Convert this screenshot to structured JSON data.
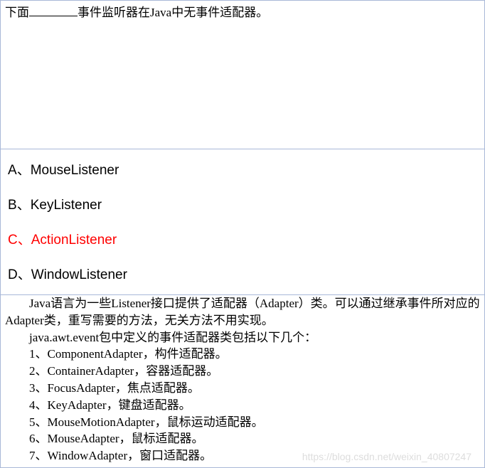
{
  "question": {
    "prefix": "下面",
    "suffix": "事件监听器在Java中无事件适配器。"
  },
  "options": [
    {
      "letter": "A",
      "text": "MouseListener",
      "correct": false
    },
    {
      "letter": "B",
      "text": "KeyListener",
      "correct": false
    },
    {
      "letter": "C",
      "text": "ActionListener",
      "correct": true
    },
    {
      "letter": "D",
      "text": "WindowListener",
      "correct": false
    }
  ],
  "sep": "、",
  "explanation": {
    "line1": "Java语言为一些Listener接口提供了适配器（Adapter）类。可以通过继承事件所对应的Adapter类，重写需要的方法，无关方法不用实现。",
    "line2": "java.awt.event包中定义的事件适配器类包括以下几个：",
    "items": [
      "1、ComponentAdapter，构件适配器。",
      "2、ContainerAdapter，容器适配器。",
      "3、FocusAdapter，焦点适配器。",
      "4、KeyAdapter，键盘适配器。",
      "5、MouseMotionAdapter，鼠标运动适配器。",
      "6、MouseAdapter，鼠标适配器。",
      "7、WindowAdapter，窗口适配器。"
    ]
  },
  "watermark": "https://blog.csdn.net/weixin_40807247"
}
